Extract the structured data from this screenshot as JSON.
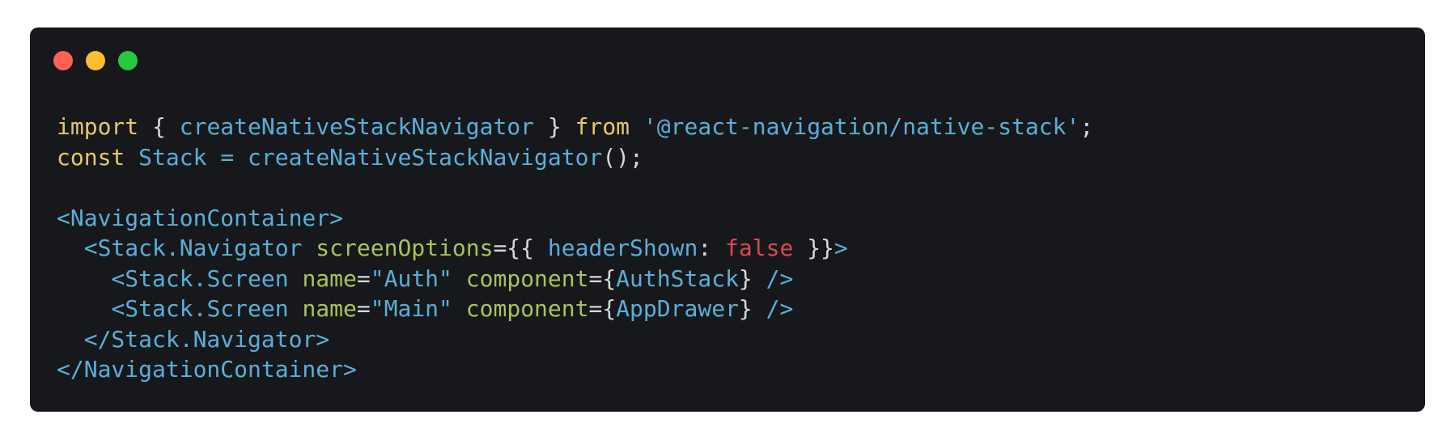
{
  "window": {
    "background": "#17181b",
    "controls": [
      {
        "name": "close",
        "color": "#fe5f57"
      },
      {
        "name": "minimize",
        "color": "#febc2e"
      },
      {
        "name": "zoom",
        "color": "#28c840"
      }
    ]
  },
  "colors": {
    "keyword": "#e6c76b",
    "identifier": "#5aafd9",
    "attribute": "#a8c35b",
    "string": "#5aafd9",
    "boolean": "#d9484f",
    "punctuation": "#d7d7d7"
  },
  "code": {
    "lines": [
      [
        {
          "text": "import",
          "kind": "keyword"
        },
        {
          "text": " { ",
          "kind": "punctuation"
        },
        {
          "text": "createNativeStackNavigator",
          "kind": "identifier"
        },
        {
          "text": " } ",
          "kind": "punctuation"
        },
        {
          "text": "from",
          "kind": "keyword"
        },
        {
          "text": " ",
          "kind": "punctuation"
        },
        {
          "text": "'@react-navigation/native-stack'",
          "kind": "string"
        },
        {
          "text": ";",
          "kind": "punctuation"
        }
      ],
      [
        {
          "text": "const",
          "kind": "keyword"
        },
        {
          "text": " ",
          "kind": "punctuation"
        },
        {
          "text": "Stack",
          "kind": "identifier"
        },
        {
          "text": " ",
          "kind": "punctuation"
        },
        {
          "text": "=",
          "kind": "identifier"
        },
        {
          "text": " ",
          "kind": "punctuation"
        },
        {
          "text": "createNativeStackNavigator",
          "kind": "identifier"
        },
        {
          "text": "();",
          "kind": "punctuation"
        }
      ],
      [],
      [
        {
          "text": "<NavigationContainer>",
          "kind": "identifier"
        }
      ],
      [
        {
          "text": "  ",
          "kind": "punctuation"
        },
        {
          "text": "<Stack.Navigator",
          "kind": "identifier"
        },
        {
          "text": " ",
          "kind": "punctuation"
        },
        {
          "text": "screenOptions",
          "kind": "attribute"
        },
        {
          "text": "={{ ",
          "kind": "punctuation"
        },
        {
          "text": "headerShown",
          "kind": "identifier"
        },
        {
          "text": ": ",
          "kind": "punctuation"
        },
        {
          "text": "false",
          "kind": "boolean"
        },
        {
          "text": " }}",
          "kind": "punctuation"
        },
        {
          "text": ">",
          "kind": "identifier"
        }
      ],
      [
        {
          "text": "    ",
          "kind": "punctuation"
        },
        {
          "text": "<Stack.Screen",
          "kind": "identifier"
        },
        {
          "text": " ",
          "kind": "punctuation"
        },
        {
          "text": "name",
          "kind": "attribute"
        },
        {
          "text": "=",
          "kind": "punctuation"
        },
        {
          "text": "\"Auth\"",
          "kind": "string"
        },
        {
          "text": " ",
          "kind": "punctuation"
        },
        {
          "text": "component",
          "kind": "attribute"
        },
        {
          "text": "={",
          "kind": "punctuation"
        },
        {
          "text": "AuthStack",
          "kind": "identifier"
        },
        {
          "text": "} ",
          "kind": "punctuation"
        },
        {
          "text": "/>",
          "kind": "identifier"
        }
      ],
      [
        {
          "text": "    ",
          "kind": "punctuation"
        },
        {
          "text": "<Stack.Screen",
          "kind": "identifier"
        },
        {
          "text": " ",
          "kind": "punctuation"
        },
        {
          "text": "name",
          "kind": "attribute"
        },
        {
          "text": "=",
          "kind": "punctuation"
        },
        {
          "text": "\"Main\"",
          "kind": "string"
        },
        {
          "text": " ",
          "kind": "punctuation"
        },
        {
          "text": "component",
          "kind": "attribute"
        },
        {
          "text": "={",
          "kind": "punctuation"
        },
        {
          "text": "AppDrawer",
          "kind": "identifier"
        },
        {
          "text": "} ",
          "kind": "punctuation"
        },
        {
          "text": "/>",
          "kind": "identifier"
        }
      ],
      [
        {
          "text": "  ",
          "kind": "punctuation"
        },
        {
          "text": "</Stack.Navigator>",
          "kind": "identifier"
        }
      ],
      [
        {
          "text": "</NavigationContainer>",
          "kind": "identifier"
        }
      ]
    ]
  }
}
